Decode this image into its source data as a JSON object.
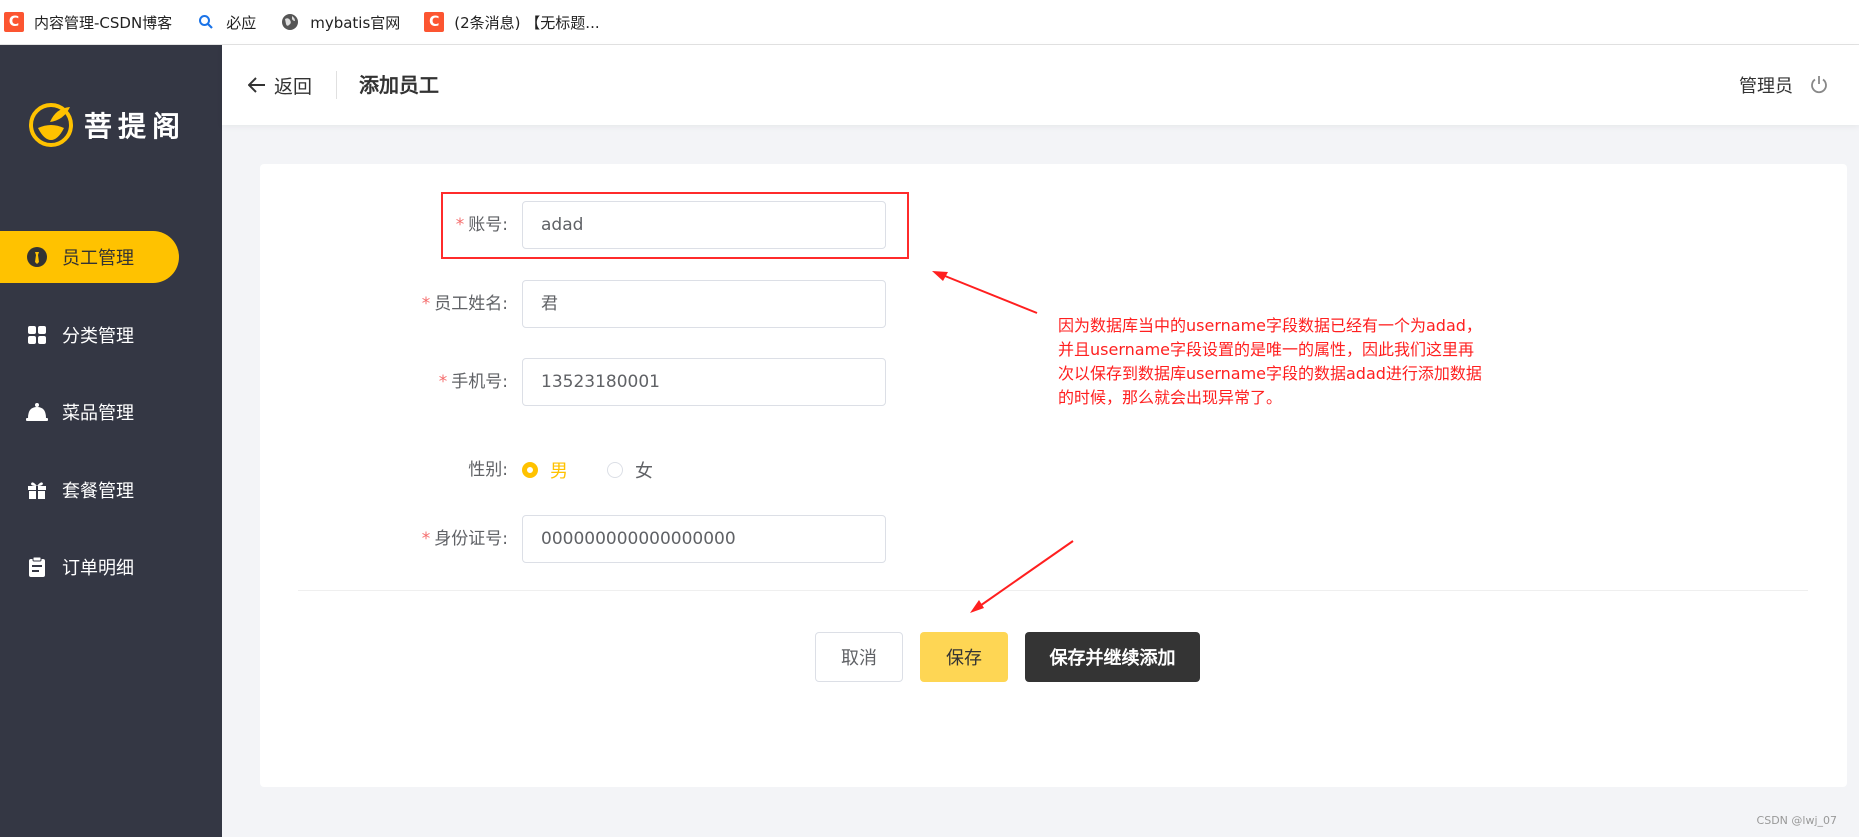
{
  "bookmarks": [
    {
      "label": "内容管理-CSDN博客",
      "icon": "csdn-icon"
    },
    {
      "label": "必应",
      "icon": "search-icon"
    },
    {
      "label": "mybatis官网",
      "icon": "globe-icon"
    },
    {
      "label": "(2条消息) 【无标题...",
      "icon": "csdn-icon"
    }
  ],
  "sidebar": {
    "logo_text": "菩提阁",
    "items": [
      {
        "label": "员工管理",
        "icon": "user-badge-icon",
        "active": true
      },
      {
        "label": "分类管理",
        "icon": "grid-icon"
      },
      {
        "label": "菜品管理",
        "icon": "cloche-icon"
      },
      {
        "label": "套餐管理",
        "icon": "gift-icon"
      },
      {
        "label": "订单明细",
        "icon": "clipboard-icon"
      }
    ]
  },
  "header": {
    "back_label": "返回",
    "title": "添加员工",
    "user_label": "管理员"
  },
  "form": {
    "account": {
      "required": "*",
      "label": "账号:",
      "value": "adad"
    },
    "name": {
      "required": "*",
      "label": "员工姓名:",
      "value": "君"
    },
    "phone": {
      "required": "*",
      "label": "手机号:",
      "value": "13523180001"
    },
    "gender": {
      "label": "性别:",
      "options": [
        "男",
        "女"
      ],
      "selected": "男"
    },
    "id_number": {
      "required": "*",
      "label": "身份证号:",
      "value": "000000000000000000"
    }
  },
  "buttons": {
    "cancel": "取消",
    "save": "保存",
    "save_continue": "保存并继续添加"
  },
  "annotation": {
    "lines": [
      "因为数据库当中的username字段数据已经有一个为adad，",
      "并且username字段设置的是唯一的属性，因此我们这里再",
      "次以保存到数据库username字段的数据adad进行添加数据",
      "的时候，那么就会出现异常了。"
    ],
    "color": "#ff1f1f"
  },
  "watermark": "CSDN @lwj_07",
  "colors": {
    "accent": "#ffc200",
    "sidebar_bg": "#343744",
    "dark_button": "#343434"
  }
}
